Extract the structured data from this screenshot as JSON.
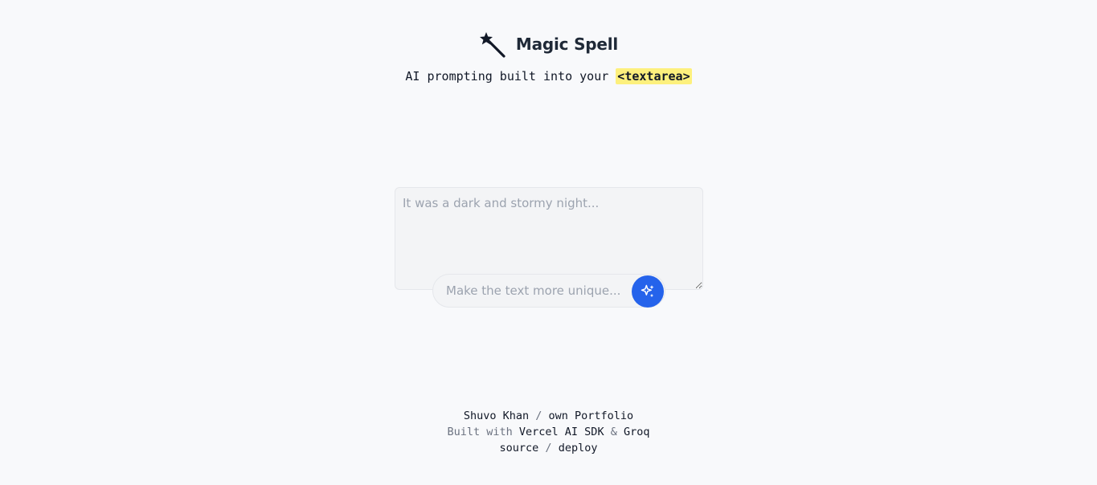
{
  "header": {
    "title": "Magic Spell",
    "tagline_text": "AI prompting built into your ",
    "tagline_code": "<textarea>",
    "icon": "magic-wand-icon"
  },
  "editor": {
    "placeholder": "It was a dark and stormy night...",
    "value": ""
  },
  "prompt": {
    "placeholder": "Make the text more unique...",
    "value": "",
    "button_icon": "sparkles-icon",
    "button_color": "#2563eb"
  },
  "footer": {
    "author": "Shuvo Khan",
    "sep1": " / ",
    "portfolio": "own Portfolio",
    "built_with": "Built with ",
    "sdk": "Vercel AI SDK",
    "amp": " & ",
    "groq": "Groq",
    "source": "source",
    "sep2": " / ",
    "deploy": "deploy"
  },
  "colors": {
    "background": "#f8f9fb",
    "highlight": "#fdf07d",
    "accent": "#2563eb"
  }
}
